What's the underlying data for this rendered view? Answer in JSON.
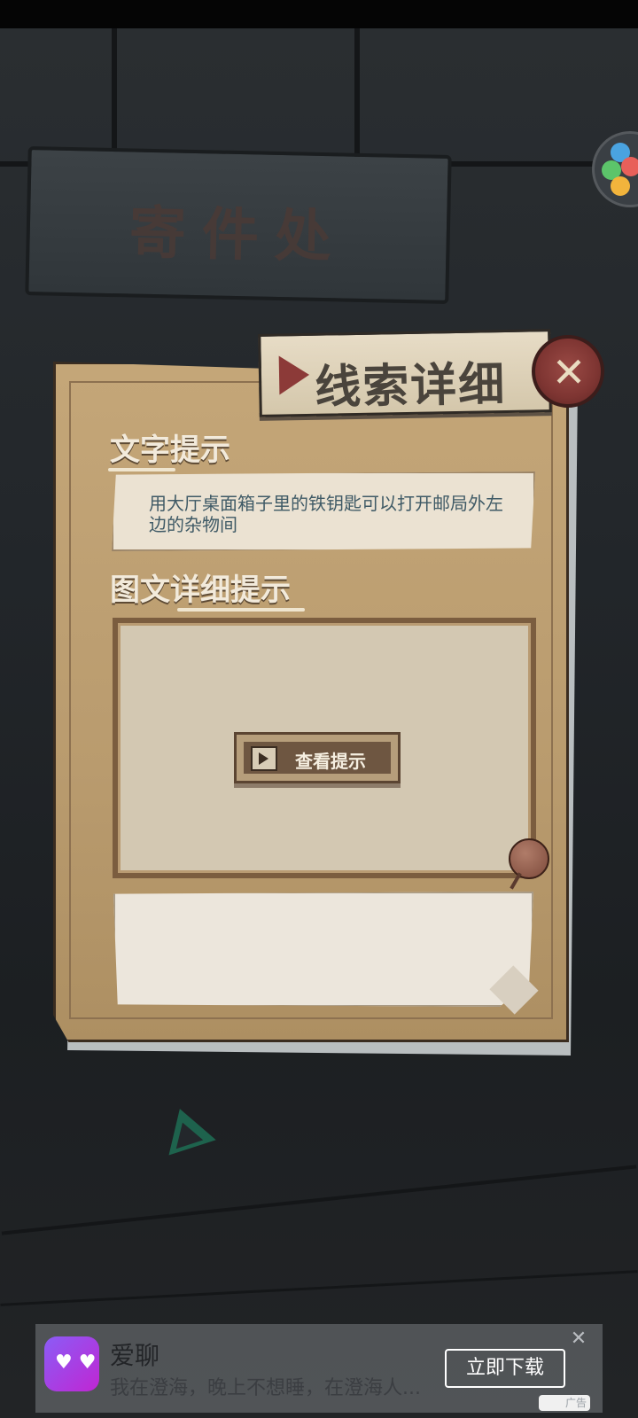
{
  "scene": {
    "sign_text": "寄件处"
  },
  "dialog": {
    "title": "线索详细",
    "text_hint_label": "文字提示",
    "text_hint": "用大厅桌面箱子里的铁钥匙可以打开邮局外左边的杂物间",
    "image_hint_label": "图文详细提示",
    "view_hint_button": "查看提示"
  },
  "ad": {
    "app_name": "爱聊",
    "subtitle": "我在澄海，晚上不想睡，在澄海人...",
    "download_button": "立即下载",
    "ad_tag": "广告"
  },
  "colors": {
    "panel": "#c4a678",
    "close_button": "#7e3532",
    "hint_text": "#3f5a66",
    "title_arrow": "#8c3a38"
  }
}
